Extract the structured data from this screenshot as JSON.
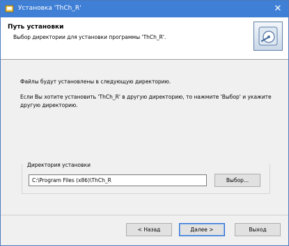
{
  "window": {
    "title": "Установка 'ThCh_R'",
    "close_glyph": "✕",
    "app_icon": "installer-icon",
    "accent_color": "#3f7fd6"
  },
  "header": {
    "title": "Путь установки",
    "subtitle": "Выбор директории для установки программы 'ThCh_R'.",
    "icon": "install-disk-icon"
  },
  "body": {
    "text1": "Файлы будут установлены в следующую директорию.",
    "text2": "Если Вы хотите установить 'ThCh_R' в другую директорию, то нажмите 'Выбор' и укажите другую директорию."
  },
  "install_dir": {
    "label": "Директория установки",
    "value": "C:\\Program Files (x86)\\ThCh_R",
    "browse_label": "Выбор..."
  },
  "buttons": {
    "back": "< Назад",
    "next": "Далее >",
    "exit": "Выход"
  }
}
